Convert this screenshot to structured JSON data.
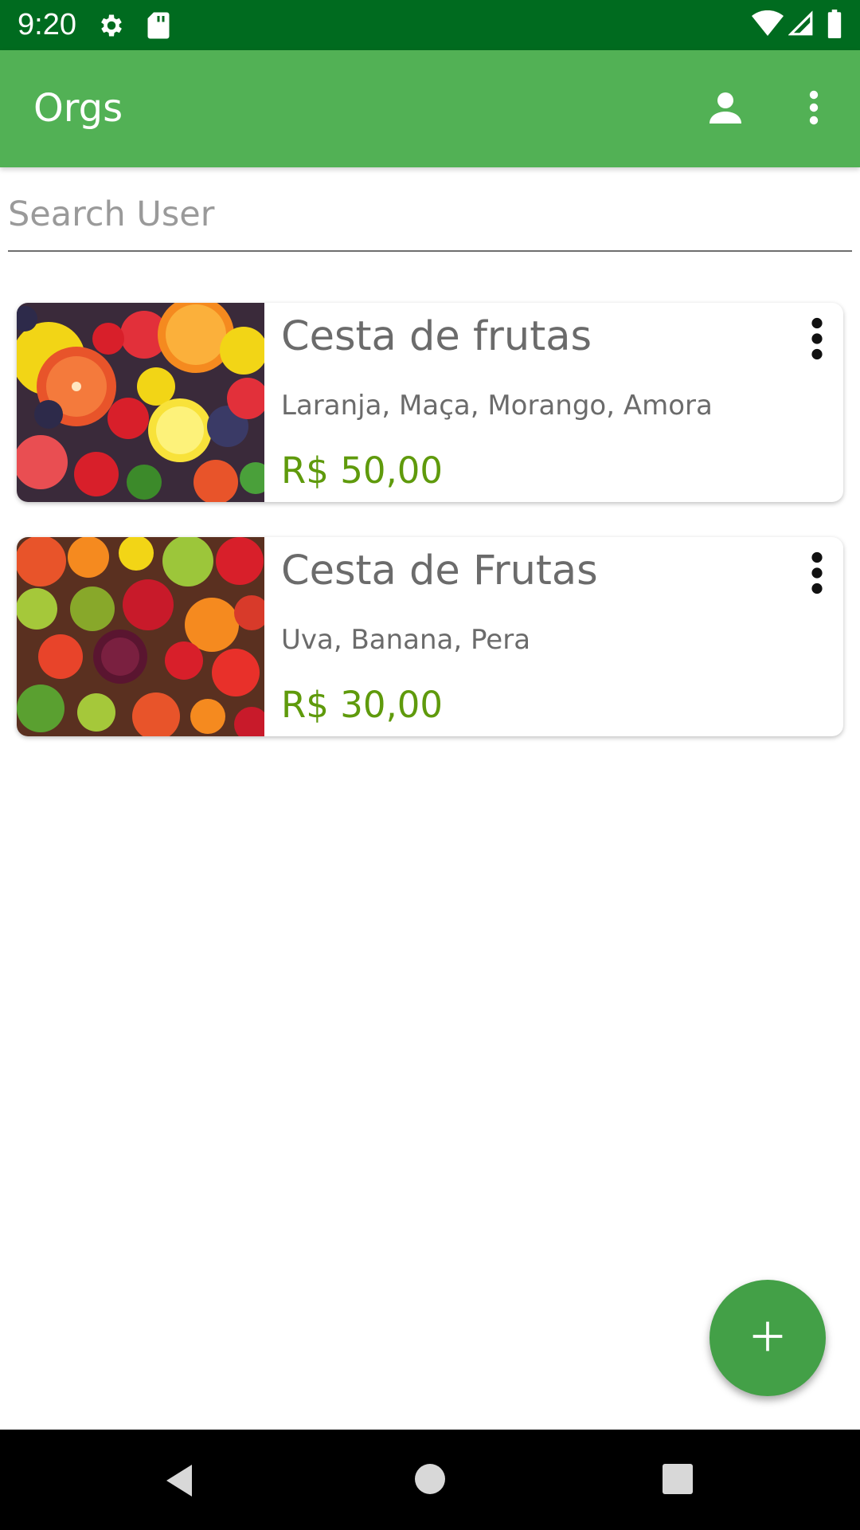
{
  "status_bar": {
    "time": "9:20",
    "icons_left": [
      "settings-icon",
      "sd-card-icon"
    ],
    "icons_right": [
      "wifi-icon",
      "signal-icon",
      "battery-icon"
    ],
    "background": "#006b1f"
  },
  "app_bar": {
    "title": "Orgs",
    "background": "#52b155",
    "icons": [
      "account-icon",
      "overflow-menu-icon"
    ]
  },
  "search": {
    "placeholder": "Search User",
    "value": ""
  },
  "products": [
    {
      "name": "Cesta de frutas",
      "description": "Laranja, Maça, Morango, Amora",
      "price": "R$ 50,00",
      "image": "fruit-basket-citrus-berries"
    },
    {
      "name": "Cesta de Frutas",
      "description": "Uva, Banana, Pera",
      "price": "R$ 30,00",
      "image": "fruit-basket-mixed"
    }
  ],
  "fab": {
    "icon": "plus-icon",
    "background": "#43a047"
  },
  "nav_bar": {
    "buttons": [
      "back-icon",
      "home-icon",
      "recents-icon"
    ]
  },
  "colors": {
    "price": "#5f9a0c",
    "text_secondary": "#6b6b6b"
  }
}
